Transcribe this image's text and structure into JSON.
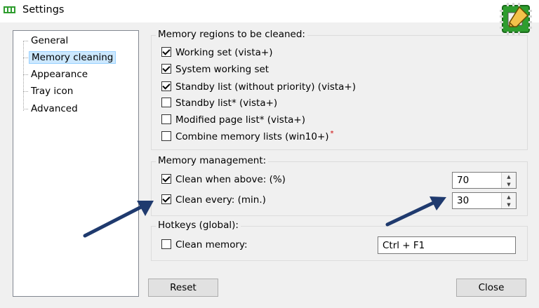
{
  "window": {
    "title": "Settings"
  },
  "tree": {
    "items": [
      {
        "label": "General",
        "selected": false
      },
      {
        "label": "Memory cleaning",
        "selected": true
      },
      {
        "label": "Appearance",
        "selected": false
      },
      {
        "label": "Tray icon",
        "selected": false
      },
      {
        "label": "Advanced",
        "selected": false
      }
    ]
  },
  "regions": {
    "title": "Memory regions to be cleaned:",
    "items": [
      {
        "label": "Working set (vista+)",
        "checked": true
      },
      {
        "label": "System working set",
        "checked": true
      },
      {
        "label": "Standby list (without priority) (vista+)",
        "checked": true
      },
      {
        "label": "Standby list* (vista+)",
        "checked": false
      },
      {
        "label": "Modified page list* (vista+)",
        "checked": false
      },
      {
        "label": "Combine memory lists (win10+)",
        "checked": false,
        "mark": "*"
      }
    ]
  },
  "management": {
    "title": "Memory management:",
    "clean_above": {
      "label": "Clean when above: (%)",
      "checked": true,
      "value": "70"
    },
    "clean_every": {
      "label": "Clean every: (min.)",
      "checked": true,
      "value": "30"
    }
  },
  "hotkeys": {
    "title": "Hotkeys (global):",
    "clean_memory": {
      "label": "Clean memory:",
      "checked": false,
      "value": "Ctrl + F1"
    }
  },
  "buttons": {
    "reset": "Reset",
    "close": "Close"
  },
  "colors": {
    "selection": "#cce8ff",
    "arrow": "#1f3a6e",
    "icon_green": "#2e9d2e"
  }
}
